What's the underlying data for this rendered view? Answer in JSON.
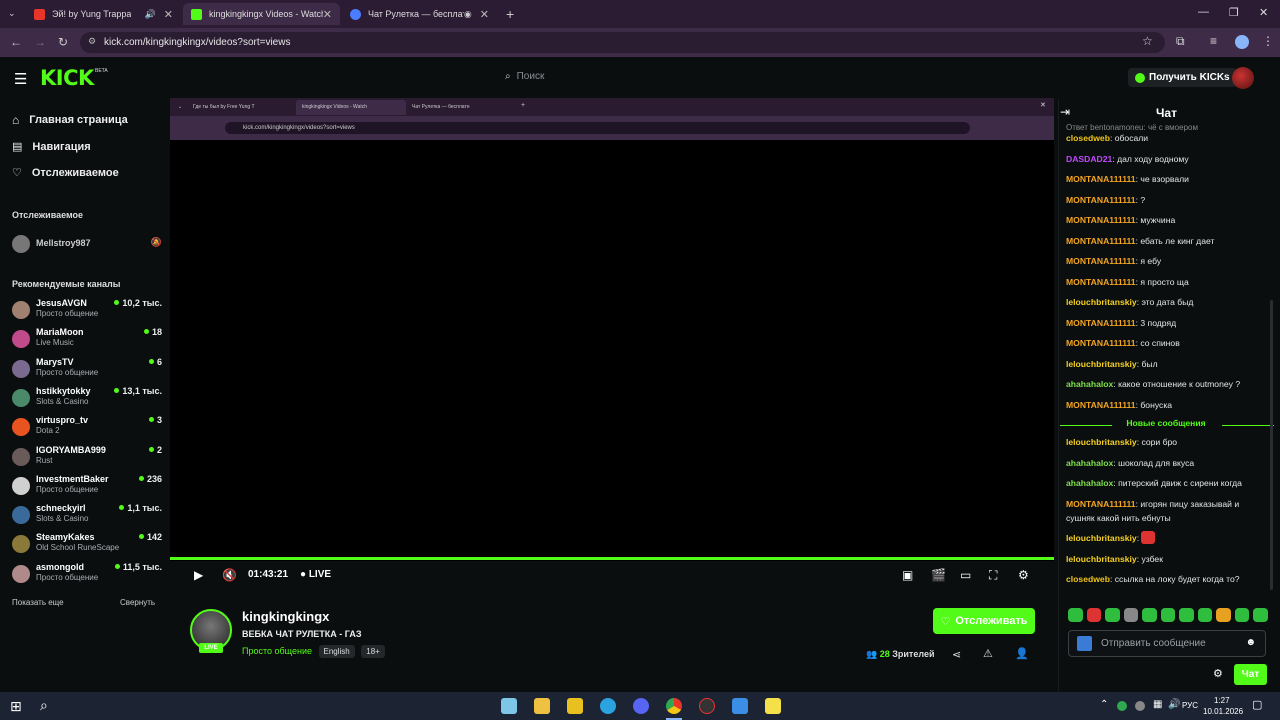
{
  "browser": {
    "tabs": [
      {
        "label": "Эй! by Yung Trappa",
        "color": "#e8352a"
      },
      {
        "label": "kingkingkingx Videos - Watch",
        "color": "#53fc18"
      },
      {
        "label": "Чат Рулетка — бесплатны",
        "color": "#4a7dff"
      }
    ],
    "url": "kick.com/kingkingkingx/videos?sort=views"
  },
  "header": {
    "logo": "KICK",
    "beta": "BETA",
    "search_placeholder": "Поиск",
    "get_kicks": "Получить KICKs"
  },
  "sidebar": {
    "nav": [
      "Главная страница",
      "Навигация",
      "Отслеживаемое"
    ],
    "following_title": "Отслеживаемое",
    "following": [
      {
        "name": "Mellstroy987"
      }
    ],
    "recommended_title": "Рекомендуемые каналы",
    "channels": [
      {
        "name": "JesusAVGN",
        "cat": "Просто общение",
        "count": "10,2 тыс.",
        "color": "#a08070"
      },
      {
        "name": "MariaMoon",
        "cat": "Live Music",
        "count": "18",
        "color": "#c04a8a"
      },
      {
        "name": "MarysTV",
        "cat": "Просто общение",
        "count": "6",
        "color": "#7a6a90"
      },
      {
        "name": "hstikkytokky",
        "cat": "Slots & Casino",
        "count": "13,1 тыс.",
        "color": "#4a8a6a"
      },
      {
        "name": "virtuspro_tv",
        "cat": "Dota 2",
        "count": "3",
        "color": "#e8531f"
      },
      {
        "name": "IGORYAMBA999",
        "cat": "Rust",
        "count": "2",
        "color": "#6a5a5a"
      },
      {
        "name": "InvestmentBaker",
        "cat": "Просто общение",
        "count": "236",
        "color": "#d0d0d0"
      },
      {
        "name": "schneckyirl",
        "cat": "Slots & Casino",
        "count": "1,1 тыс.",
        "color": "#3a6a9a"
      },
      {
        "name": "SteamyKakes",
        "cat": "Old School RuneScape",
        "count": "142",
        "color": "#8a7a3a"
      },
      {
        "name": "asmongold",
        "cat": "Просто общение",
        "count": "11,5 тыс.",
        "color": "#b08a8a"
      }
    ],
    "show_more": "Показать еще",
    "collapse": "Свернуть"
  },
  "inner_browser": {
    "tabs": [
      "Где ты был by Free Yung T",
      "kingkingkingx Videos - Watch",
      "Чат Рулетка — бесплатн"
    ],
    "url": "kick.com/kingkingkingx/videos?sort=views"
  },
  "player": {
    "time": "01:43:21",
    "live": "LIVE"
  },
  "stream": {
    "name": "kingkingkingx",
    "title": "ВЕБКА ЧАТ РУЛЕТКА - ГАЗ",
    "category": "Просто общение",
    "tags": [
      "English",
      "18+"
    ],
    "live_badge": "LIVE",
    "follow": "Отслеживать",
    "viewers": "28",
    "viewers_label": "Зрителей"
  },
  "chat": {
    "title": "Чат",
    "top_partial": "Ответ bentonamoneu: чё с вмоером",
    "messages": [
      {
        "user": "closedweb",
        "color": "#f0c419",
        "text": "обосали"
      },
      {
        "user": "DASDAD21",
        "color": "#c04aff",
        "text": "дал ходу водному"
      },
      {
        "user": "MONTANA111111",
        "color": "#f5a623",
        "text": "че взорвали"
      },
      {
        "user": "MONTANA111111",
        "color": "#f5a623",
        "text": "?"
      },
      {
        "user": "MONTANA111111",
        "color": "#f5a623",
        "text": "мужчина"
      },
      {
        "user": "MONTANA111111",
        "color": "#f5a623",
        "text": "ебать ле кинг дает"
      },
      {
        "user": "MONTANA111111",
        "color": "#f5a623",
        "text": "я ебу"
      },
      {
        "user": "MONTANA111111",
        "color": "#f5a623",
        "text": "я просто ща"
      },
      {
        "user": "lelouchbritanskiy",
        "color": "#f5d020",
        "text": "это дата быд"
      },
      {
        "user": "MONTANA111111",
        "color": "#f5a623",
        "text": "3 подряд"
      },
      {
        "user": "MONTANA111111",
        "color": "#f5a623",
        "text": "со спинов"
      },
      {
        "user": "lelouchbritanskiy",
        "color": "#f5d020",
        "text": "был"
      },
      {
        "user": "ahahahalox",
        "color": "#7ee04a",
        "text": "какое отношение к outmoney ?"
      },
      {
        "user": "MONTANA111111",
        "color": "#f5a623",
        "text": "бонуска"
      }
    ],
    "new_messages": "Новые сообщения",
    "new": [
      {
        "user": "lelouchbritanskiy",
        "color": "#f5d020",
        "text": "сори бро"
      },
      {
        "user": "ahahahalox",
        "color": "#7ee04a",
        "text": "шоколад для вкуса"
      },
      {
        "user": "ahahahalox",
        "color": "#7ee04a",
        "text": "питерский движ с сирени когда"
      },
      {
        "user": "MONTANA111111",
        "color": "#f5a623",
        "text": "игорян пицу заказывай и сушняк какой нить ебнуты"
      },
      {
        "user": "lelouchbritanskiy",
        "color": "#f5d020",
        "text": ""
      },
      {
        "user": "lelouchbritanskiy",
        "color": "#f5d020",
        "text": "узбек"
      },
      {
        "user": "closedweb",
        "color": "#f0c419",
        "text": "ссылка на локу будет когда то?"
      }
    ],
    "placeholder": "Отправить сообщение",
    "send": "Чат"
  },
  "taskbar": {
    "lang": "РУС",
    "time": "1:27",
    "date": "10.01.2026"
  }
}
